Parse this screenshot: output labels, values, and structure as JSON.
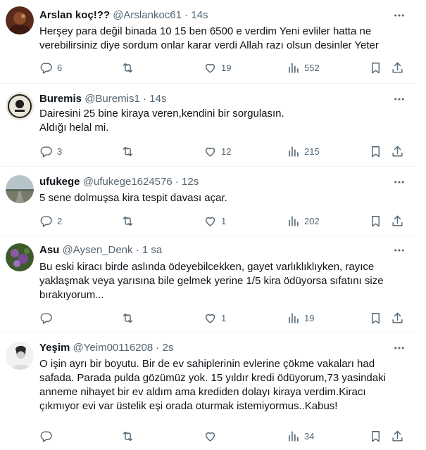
{
  "tweets": [
    {
      "name": "Arslan koç!??",
      "handle": "@Arslankoc61",
      "dot": "·",
      "time": "14s",
      "text": "Herşey para değil binada 10 15 ben 6500 e verdim Yeni evliler hatta ne\nverebilirsiniz diye sordum onlar karar verdi Allah razı olsun desinler Yeter",
      "replies": "6",
      "retweets": "",
      "likes": "19",
      "views": "552"
    },
    {
      "name": "Buremis",
      "handle": "@Buremis1",
      "dot": "·",
      "time": "14s",
      "text": "Dairesini 25 bine kiraya veren,kendini bir sorgulasın.\nAldığı helal mi.",
      "replies": "3",
      "retweets": "",
      "likes": "12",
      "views": "215"
    },
    {
      "name": "ufukege",
      "handle": "@ufukege1624576",
      "dot": "·",
      "time": "12s",
      "text": "5 sene dolmuşsa kira tespit davası açar.",
      "replies": "2",
      "retweets": "",
      "likes": "1",
      "views": "202"
    },
    {
      "name": "Asu",
      "handle": "@Aysen_Denk",
      "dot": "·",
      "time": "1 sa",
      "text": "Bu eski kiracı birde aslında ödeyebilcekken, gayet varlıklıklıyken, rayıce\nyaklaşmak veya yarısına bile gelmek yerine  1/5 kira ödüyorsa sıfatını size\nbırakıyorum...",
      "replies": "",
      "retweets": "",
      "likes": "1",
      "views": "19"
    },
    {
      "name": "Yeşim",
      "handle": "@Yeim00116208",
      "dot": "·",
      "time": "2s",
      "text": "O işin ayrı bir boyutu. Bir de ev sahiplerinin evlerine çökme vakaları had\nsafada. Parada pulda gözümüz yok. 15 yıldır kredi ödüyorum,73 yasindaki\nanneme nihayet bir ev aldım ama krediden dolayı kiraya verdim.Kiracı\nçıkmıyor  evi var üstelik eşi orada oturmak istemiyormus..Kabus!",
      "replies": "",
      "retweets": "",
      "likes": "",
      "views": "34"
    }
  ],
  "icons": {
    "reply": "reply-icon",
    "retweet": "retweet-icon",
    "like": "heart-icon",
    "views": "views-icon",
    "bookmark": "bookmark-icon",
    "share": "share-icon",
    "more": "more-icon"
  }
}
